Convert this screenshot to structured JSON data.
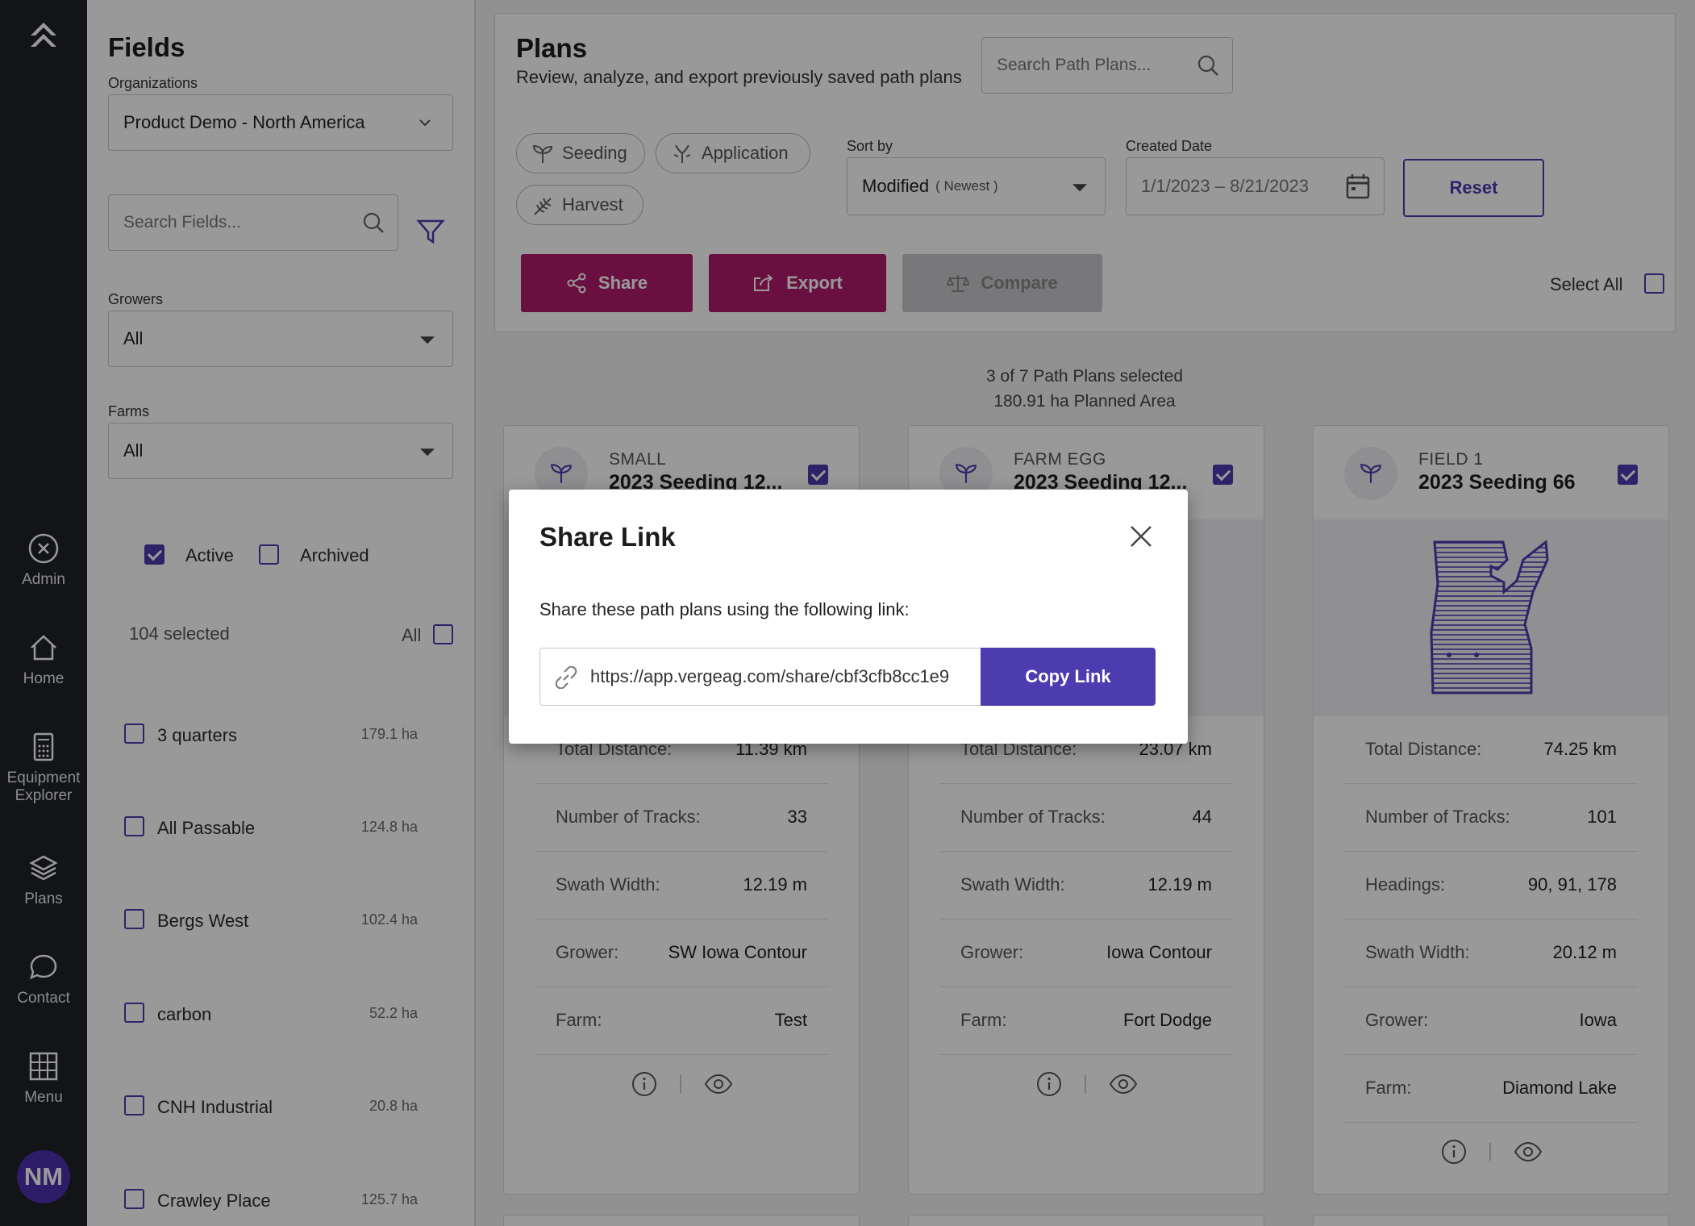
{
  "rail": {
    "items": [
      {
        "label": "Admin",
        "icon": "close-circle-icon"
      },
      {
        "label": "Home",
        "icon": "home-icon"
      },
      {
        "label": "Equipment Explorer",
        "icon": "calculator-icon"
      },
      {
        "label": "Plans",
        "icon": "layers-icon"
      },
      {
        "label": "Contact",
        "icon": "chat-icon"
      },
      {
        "label": "Menu",
        "icon": "grid-icon"
      }
    ],
    "avatar": "NM"
  },
  "fields_panel": {
    "title": "Fields",
    "org_label": "Organizations",
    "org_value": "Product Demo - North America",
    "search_placeholder": "Search Fields...",
    "growers_label": "Growers",
    "growers_value": "All",
    "farms_label": "Farms",
    "farms_value": "All",
    "active_label": "Active",
    "archived_label": "Archived",
    "selected_count": "104 selected",
    "all_label": "All",
    "fields": [
      {
        "name": "3 quarters",
        "area": "179.1 ha"
      },
      {
        "name": "All Passable",
        "area": "124.8 ha"
      },
      {
        "name": "Bergs West",
        "area": "102.4 ha"
      },
      {
        "name": "carbon",
        "area": "52.2 ha"
      },
      {
        "name": "CNH Industrial",
        "area": "20.8 ha"
      },
      {
        "name": "Crawley Place",
        "area": "125.7 ha"
      }
    ]
  },
  "plans_panel": {
    "title": "Plans",
    "subtitle": "Review, analyze, and export previously saved path plans",
    "search_placeholder": "Search Path Plans...",
    "chips": [
      "Seeding",
      "Application",
      "Harvest"
    ],
    "sort_label": "Sort by",
    "sort_value": "Modified",
    "sort_suffix": "( Newest )",
    "date_label": "Created Date",
    "date_value": "1/1/2023 – 8/21/2023",
    "reset_label": "Reset",
    "share_label": "Share",
    "export_label": "Export",
    "compare_label": "Compare",
    "select_all_label": "Select All",
    "summary_line1": "3 of 7 Path Plans selected",
    "summary_line2": "180.91 ha Planned Area"
  },
  "cards": [
    {
      "field": "SMALL",
      "name": "2023 Seeding 12...",
      "rows": [
        {
          "k": "Total Distance:",
          "v": "11.39 km"
        },
        {
          "k": "Number of Tracks:",
          "v": "33"
        },
        {
          "k": "Swath Width:",
          "v": "12.19 m"
        },
        {
          "k": "Grower:",
          "v": "SW Iowa Contour"
        },
        {
          "k": "Farm:",
          "v": "Test"
        }
      ]
    },
    {
      "field": "FARM EGG",
      "name": "2023 Seeding 12...",
      "rows": [
        {
          "k": "Total Distance:",
          "v": "23.07 km"
        },
        {
          "k": "Number of Tracks:",
          "v": "44"
        },
        {
          "k": "Swath Width:",
          "v": "12.19 m"
        },
        {
          "k": "Grower:",
          "v": "Iowa Contour"
        },
        {
          "k": "Farm:",
          "v": "Fort Dodge"
        }
      ]
    },
    {
      "field": "FIELD 1",
      "name": "2023 Seeding 66",
      "rows": [
        {
          "k": "Total Distance:",
          "v": "74.25 km"
        },
        {
          "k": "Number of Tracks:",
          "v": "101"
        },
        {
          "k": "Headings:",
          "v": "90, 91, 178"
        },
        {
          "k": "Swath Width:",
          "v": "20.12 m"
        },
        {
          "k": "Grower:",
          "v": "Iowa"
        },
        {
          "k": "Farm:",
          "v": "Diamond Lake"
        }
      ]
    }
  ],
  "modal": {
    "title": "Share Link",
    "description": "Share these path plans using the following link:",
    "url": "https://app.vergeag.com/share/cbf3cfb8cc1e9",
    "copy_label": "Copy Link"
  },
  "colors": {
    "accent": "#4d3bb0",
    "share_button": "#b11c6d",
    "rail": "#1f2228"
  }
}
